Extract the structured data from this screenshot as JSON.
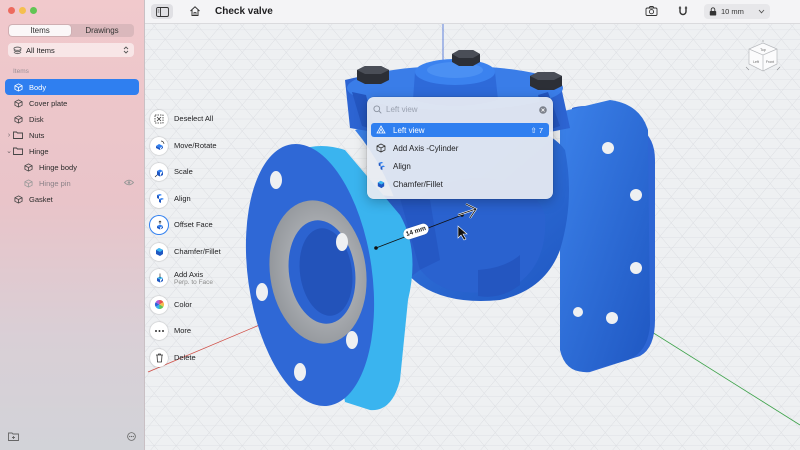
{
  "sidebar": {
    "tabs": [
      {
        "label": "Items",
        "active": true
      },
      {
        "label": "Drawings",
        "active": false
      }
    ],
    "filter_label": "All Items",
    "section_label": "Items",
    "items": [
      {
        "label": "Body",
        "selected": true
      },
      {
        "label": "Cover plate"
      },
      {
        "label": "Disk"
      },
      {
        "label": "Nuts",
        "folder": true
      },
      {
        "label": "Hinge",
        "folder": true,
        "expanded": true
      },
      {
        "label": "Hinge body",
        "indent": true
      },
      {
        "label": "Hinge pin",
        "indent": true,
        "hidden": true
      },
      {
        "label": "Gasket"
      }
    ]
  },
  "toolbar": {
    "title": "Check valve",
    "unit_label": "10 mm"
  },
  "tools": [
    {
      "label": "Deselect All",
      "icon": "deselect-icon"
    },
    {
      "label": "Move/Rotate",
      "icon": "move-rotate-icon"
    },
    {
      "label": "Scale",
      "icon": "scale-icon"
    },
    {
      "label": "Align",
      "icon": "align-icon"
    },
    {
      "label": "Offset Face",
      "icon": "offset-face-icon",
      "active": true
    },
    {
      "label": "Chamfer/Fillet",
      "icon": "chamfer-icon"
    },
    {
      "label": "Add Axis",
      "sublabel": "Perp. to Face",
      "icon": "add-axis-icon"
    },
    {
      "label": "Color",
      "icon": "color-icon"
    },
    {
      "label": "More",
      "icon": "more-icon"
    },
    {
      "label": "Delete",
      "icon": "trash-icon"
    }
  ],
  "palette": {
    "placeholder": "Left view",
    "items": [
      {
        "label": "Left view",
        "shortcut": "⇧ 7",
        "selected": true
      },
      {
        "label": "Add Axis -Cylinder"
      },
      {
        "label": "Align"
      },
      {
        "label": "Chamfer/Fillet"
      }
    ]
  },
  "dimension_label": "14 mm",
  "viewcube": {
    "top": "Top",
    "front": "Front",
    "left": "Left"
  },
  "colors": {
    "accent": "#2f7ff0",
    "model": "#2e6fdc",
    "model_light": "#37b2ee"
  }
}
